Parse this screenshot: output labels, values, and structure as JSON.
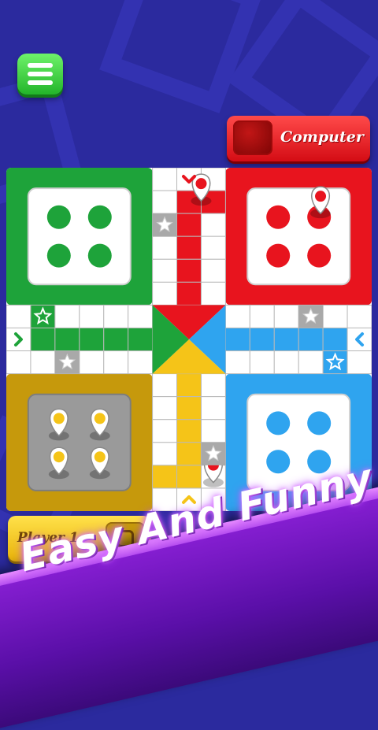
{
  "background": {
    "color": "#2b2a9e"
  },
  "header": {
    "menu_icon": "hamburger-menu-icon"
  },
  "opponent": {
    "name": "Computer",
    "color": "#e51c23"
  },
  "player": {
    "name": "Player 1",
    "color": "#ffcc1a"
  },
  "board": {
    "colors": {
      "green": "#1ea33a",
      "red": "#e8141e",
      "yellow": "#f5c418",
      "blue": "#2fa4ef",
      "white": "#ffffff",
      "grid": "#b9b9b9",
      "ochre": "#c6990c"
    },
    "home_dice": [
      {
        "corner": "top-left",
        "color": "green",
        "pips": 4
      },
      {
        "corner": "top-right",
        "color": "red",
        "pips": 4
      },
      {
        "corner": "bottom-right",
        "color": "blue",
        "pips": 4
      }
    ],
    "yellow_tokens_at_home": 4,
    "safe_star_icon": "star-icon",
    "arrow_icons": [
      "chevron-down-icon",
      "chevron-right-icon",
      "chevron-left-icon",
      "chevron-up-icon"
    ],
    "red_token_icon": "map-pin-icon"
  },
  "banner": {
    "text": "Easy And Funny"
  }
}
